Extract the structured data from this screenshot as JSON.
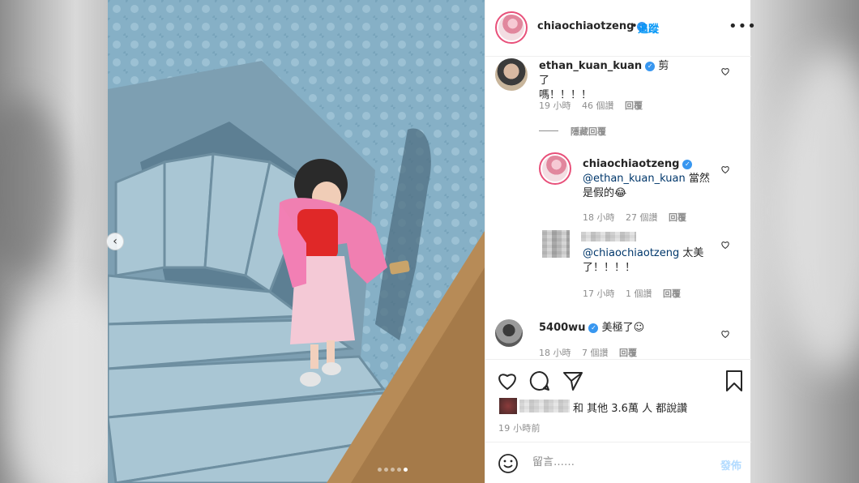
{
  "post": {
    "author": "chiaochiaotzeng",
    "follow_label": "追蹤",
    "more_label": "•••",
    "separator": "•"
  },
  "photo": {
    "prev_label": "‹",
    "slide_count": 5,
    "active_slide": 5
  },
  "comments": [
    {
      "author": "ethan_kuan_kuan",
      "verified": true,
      "text_line1": "剪了",
      "text_line2": "嗎！！！！",
      "time": "19 小時",
      "likes": "46 個讚",
      "reply_label": "回覆",
      "hide_replies_label": "隱藏回覆",
      "replies": [
        {
          "author": "chiaochiaotzeng",
          "verified": true,
          "mention": "@ethan_kuan_kuan",
          "text_line1": " 當然",
          "text_line2": "是假的😂",
          "time": "18 小時",
          "likes": "27 個讚",
          "reply_label": "回覆"
        },
        {
          "author_hidden": true,
          "mention": "@chiaochiaotzeng",
          "text_line1": " 太美",
          "text_line2": "了！！！！",
          "time": "17 小時",
          "likes": "1 個讚",
          "reply_label": "回覆"
        }
      ]
    },
    {
      "author": "5400wu",
      "verified": true,
      "text_line1": "美極了☺",
      "time": "18 小時",
      "likes": "7 個讚",
      "reply_label": "回覆"
    }
  ],
  "actions": {
    "icons": [
      "heart-icon",
      "comment-icon",
      "share-icon",
      "bookmark-icon"
    ],
    "likes_text": "和 其他 3.6萬 人 都說讚",
    "timestamp": "19 小時前"
  },
  "add_comment": {
    "placeholder": "留言……",
    "post_label": "發佈"
  },
  "colors": {
    "accent": "#0095f6",
    "verified": "#3897f0",
    "post_disabled": "#b3dbff",
    "muted": "#8e8e8e"
  }
}
